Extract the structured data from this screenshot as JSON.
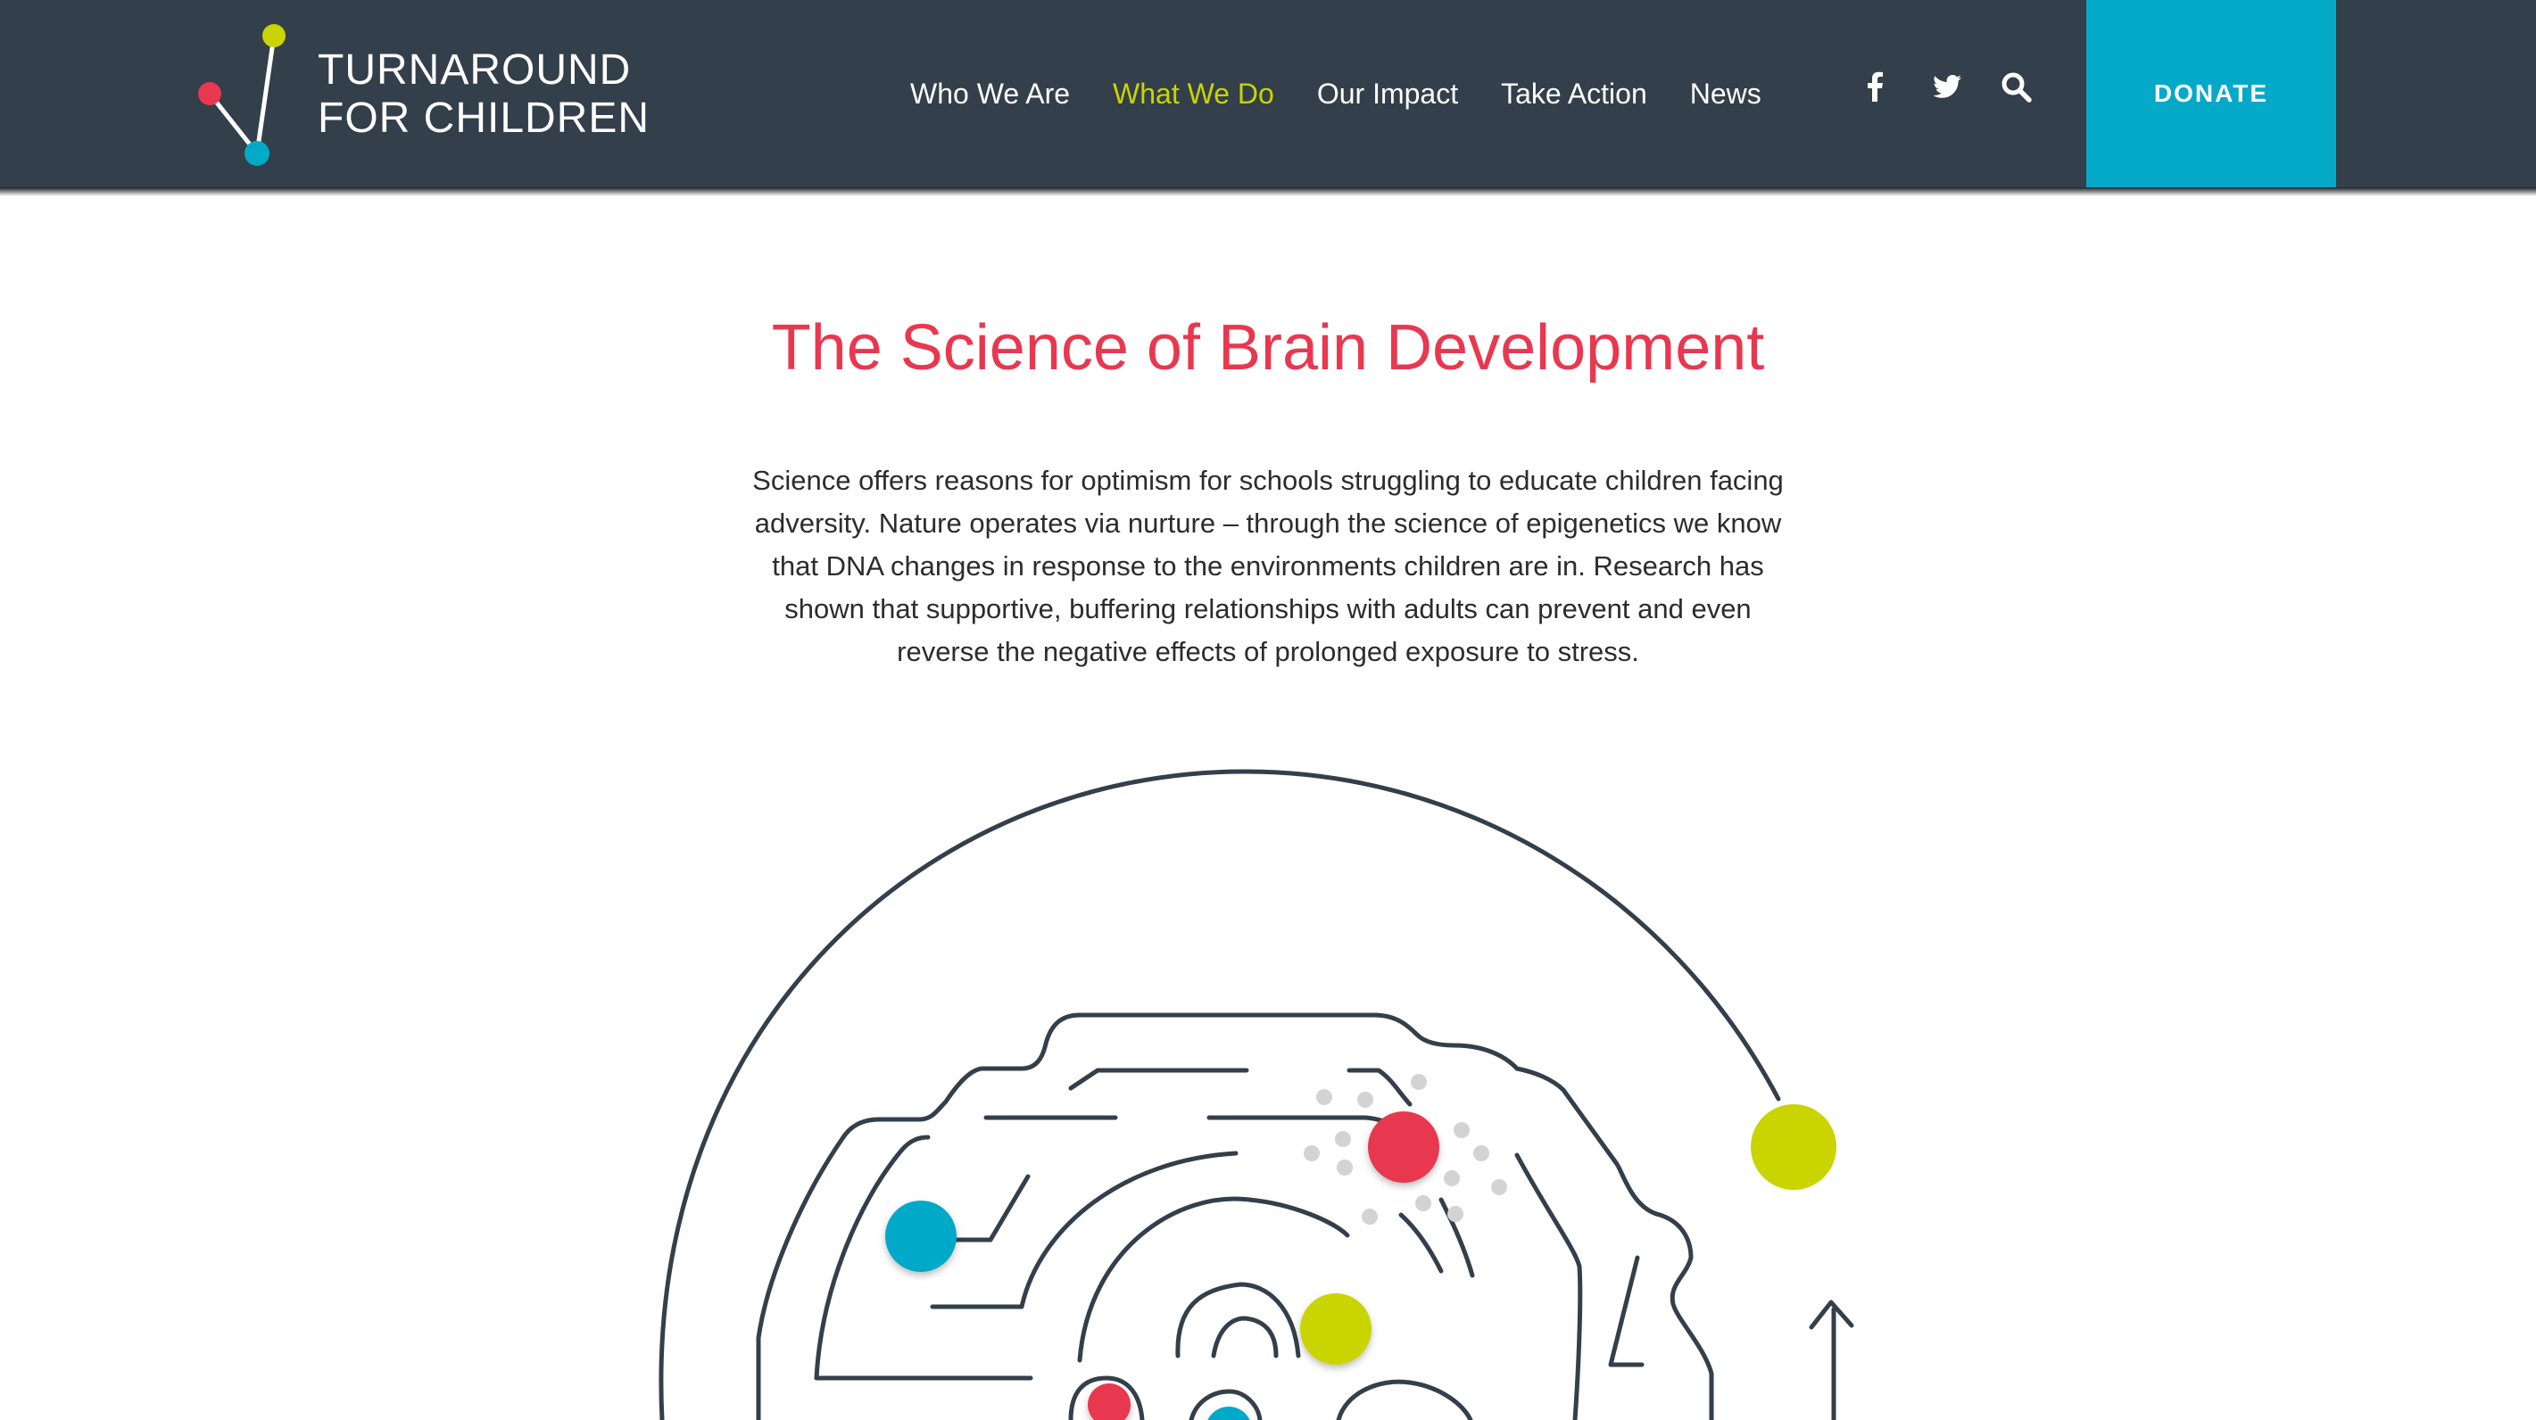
{
  "brand": {
    "line1": "TURNAROUND",
    "line2": "FOR CHILDREN",
    "colors": {
      "header": "#333f4a",
      "accent_red": "#e8384f",
      "accent_lime": "#c9d400",
      "accent_cyan": "#04a9c7"
    }
  },
  "nav": {
    "items": [
      {
        "label": "Who We Are",
        "active": false
      },
      {
        "label": "What We Do",
        "active": true
      },
      {
        "label": "Our Impact",
        "active": false
      },
      {
        "label": "Take Action",
        "active": false
      },
      {
        "label": "News",
        "active": false
      }
    ],
    "icons": [
      "facebook-icon",
      "twitter-icon",
      "search-icon"
    ],
    "donate_label": "DONATE"
  },
  "main": {
    "title": "The Science of Brain Development",
    "intro_lines": [
      "Science offers reasons for optimism for schools struggling to educate children facing",
      "adversity. Nature operates via nurture – through the science of epigenetics we know",
      "that DNA changes in response to the environments children are in. Research has",
      "shown that supportive, buffering relationships with adults can prevent and even",
      "reverse the negative effects of prolonged exposure to stress."
    ]
  }
}
